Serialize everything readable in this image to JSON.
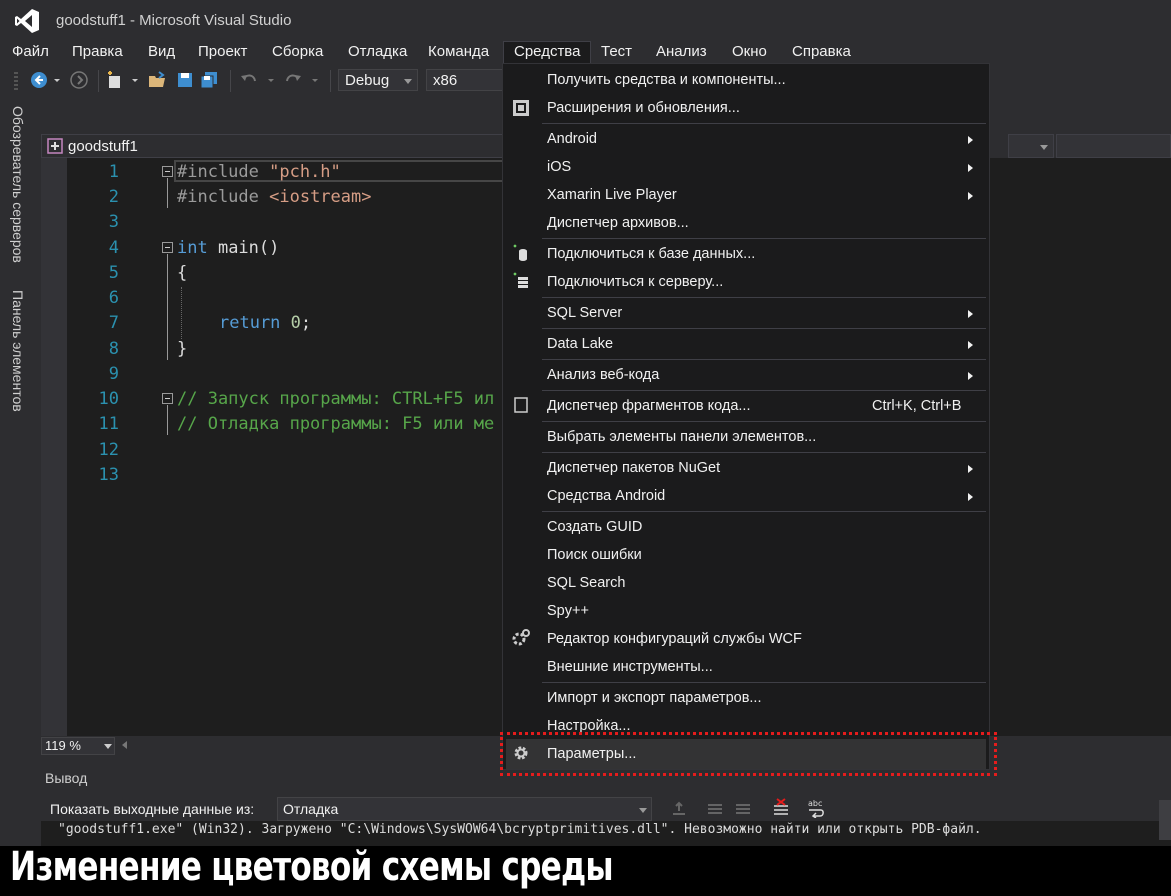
{
  "window": {
    "title": "goodstuff1 - Microsoft Visual Studio"
  },
  "menubar": {
    "items": [
      "Файл",
      "Правка",
      "Вид",
      "Проект",
      "Сборка",
      "Отладка",
      "Команда",
      "Средства",
      "Тест",
      "Анализ",
      "Окно",
      "Справка"
    ],
    "active": "Средства"
  },
  "toolbar": {
    "configuration": "Debug",
    "platform": "x86"
  },
  "side_tabs": {
    "server_explorer": "Обозреватель серверов",
    "toolbox": "Панель элементов"
  },
  "editor": {
    "file_tab": "goodstuff1",
    "zoom": "119 %",
    "line_numbers": [
      "1",
      "2",
      "3",
      "4",
      "5",
      "6",
      "7",
      "8",
      "9",
      "10",
      "11",
      "12",
      "13"
    ],
    "lines": {
      "l1_directive": "#include",
      "l1_value": " \"pch.h\"",
      "l2_directive": "#include",
      "l2_value": " <iostream>",
      "l4_type": "int",
      "l4_rest": " main()",
      "l5": "{",
      "l7_keyword": "return",
      "l7_number": "0",
      "l7_end": ";",
      "l8": "}",
      "l10": "// Запуск программы: CTRL+F5 ил",
      "l11": "// Отладка программы: F5 или ме"
    }
  },
  "dropdown": {
    "items": [
      {
        "label": "Получить средства и компоненты...",
        "submenu": false
      },
      {
        "label": "Расширения и обновления...",
        "submenu": false,
        "icon": "extensions-icon"
      },
      {
        "label": "Android",
        "submenu": true
      },
      {
        "label": "iOS",
        "submenu": true
      },
      {
        "label": "Xamarin Live Player",
        "submenu": true
      },
      {
        "label": "Диспетчер архивов...",
        "submenu": false
      },
      {
        "label": "Подключиться к базе данных...",
        "submenu": false,
        "icon": "connect-database-icon"
      },
      {
        "label": "Подключиться к серверу...",
        "submenu": false,
        "icon": "connect-server-icon"
      },
      {
        "label": "SQL Server",
        "submenu": true
      },
      {
        "label": "Data Lake",
        "submenu": true
      },
      {
        "label": "Анализ веб-кода",
        "submenu": true
      },
      {
        "label": "Диспетчер фрагментов кода...",
        "submenu": false,
        "shortcut": "Ctrl+K, Ctrl+B",
        "icon": "snippet-manager-icon"
      },
      {
        "label": "Выбрать элементы панели элементов...",
        "submenu": false
      },
      {
        "label": "Диспетчер пакетов NuGet",
        "submenu": true
      },
      {
        "label": "Средства Android",
        "submenu": true
      },
      {
        "label": "Создать GUID",
        "submenu": false
      },
      {
        "label": "Поиск ошибки",
        "submenu": false
      },
      {
        "label": "SQL Search",
        "submenu": false
      },
      {
        "label": "Spy++",
        "submenu": false
      },
      {
        "label": "Редактор конфигураций службы WCF",
        "submenu": false,
        "icon": "wcf-config-icon"
      },
      {
        "label": "Внешние инструменты...",
        "submenu": false
      },
      {
        "label": "Импорт и экспорт параметров...",
        "submenu": false
      },
      {
        "label": "Настройка...",
        "submenu": false
      },
      {
        "label": "Параметры...",
        "submenu": false,
        "icon": "gear-icon",
        "highlighted": true
      }
    ]
  },
  "output": {
    "title": "Вывод",
    "show_from_label": "Показать выходные данные из:",
    "source": "Отладка",
    "line": "\"goodstuff1.exe\" (Win32). Загружено \"C:\\Windows\\SysWOW64\\bcryptprimitives.dll\". Невозможно найти или открыть PDB-файл."
  },
  "caption": "Изменение цветовой схемы среды",
  "colors": {
    "background": "#2d2d30",
    "editor": "#1e1e1e",
    "menu": "#1b1b1c",
    "keyword": "#569cd6",
    "string": "#d69d85",
    "comment": "#57a64a",
    "line_number": "#2b91af",
    "highlight_border": "#e51c1c"
  }
}
